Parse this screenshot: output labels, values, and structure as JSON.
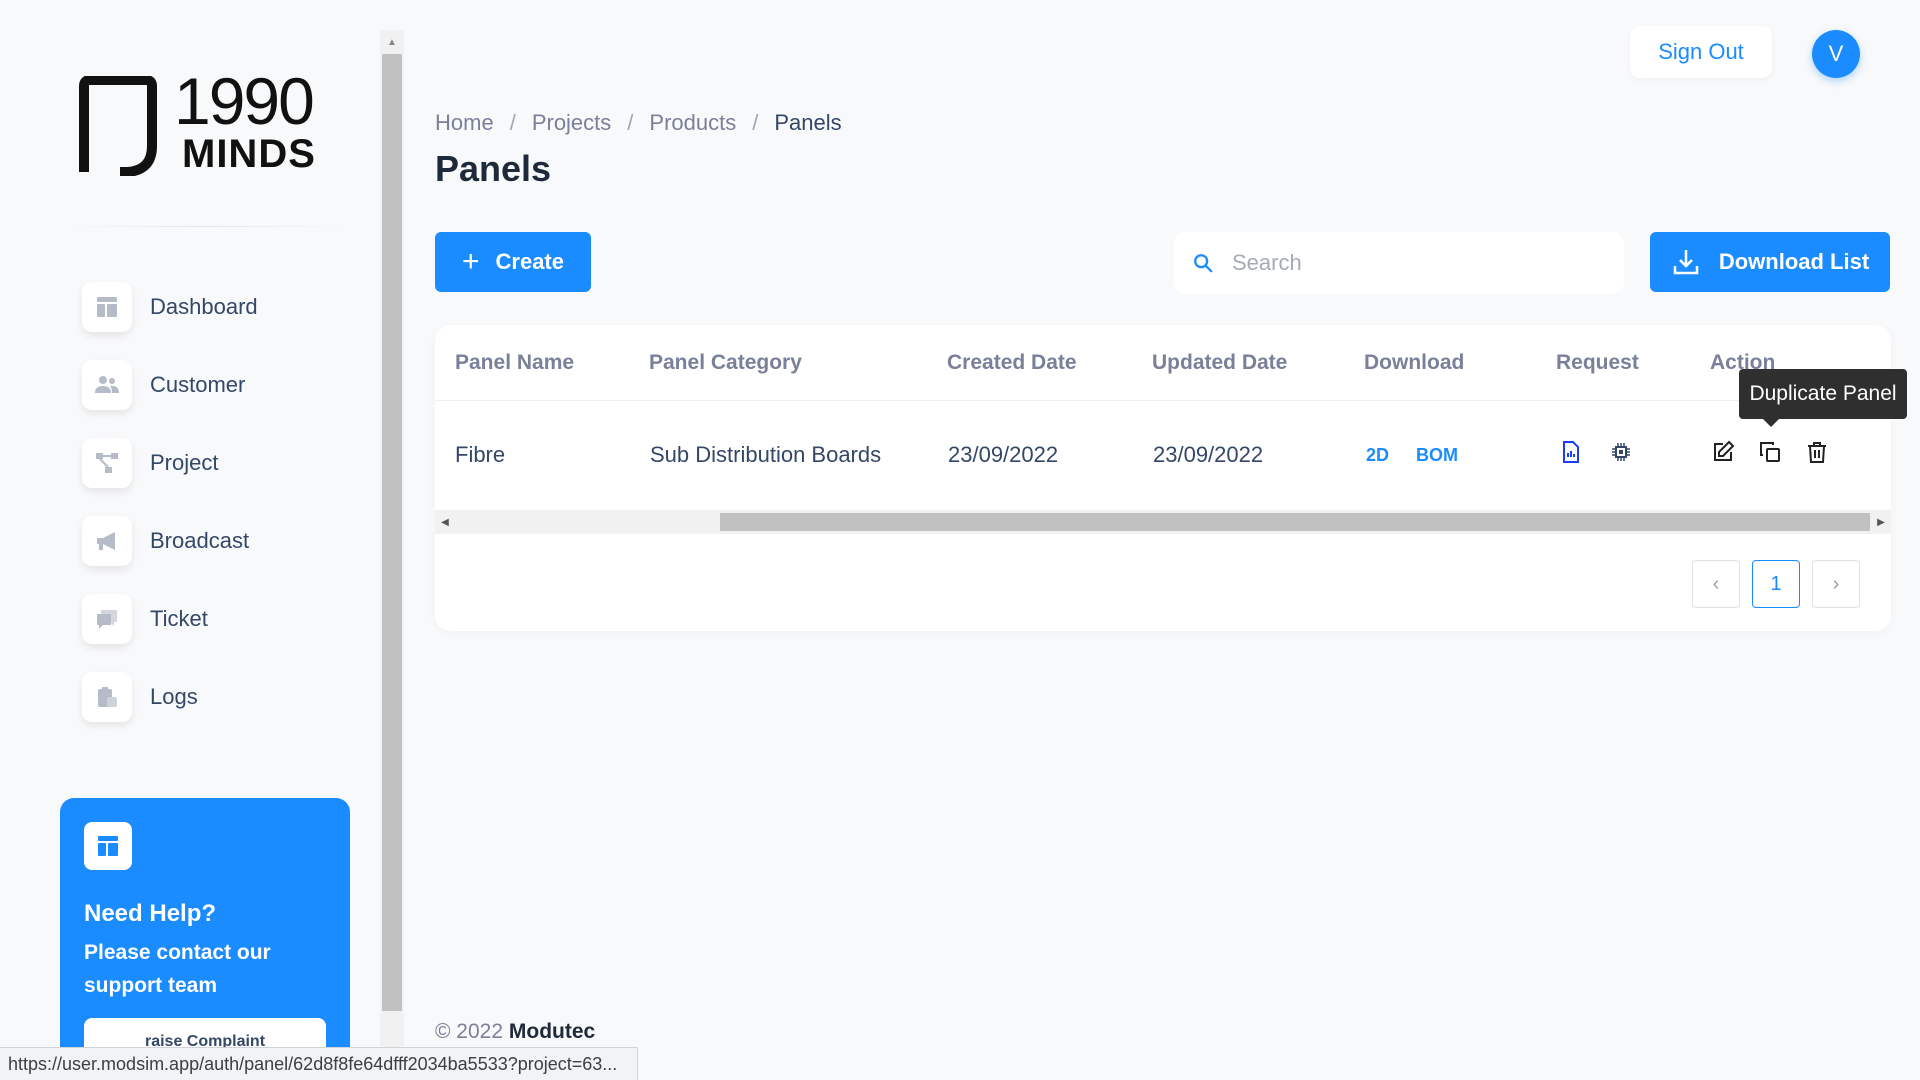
{
  "brand": {
    "logo_line1": "1990",
    "logo_line2": "MINDS"
  },
  "sidebar": {
    "items": [
      {
        "label": "Dashboard",
        "icon": "dashboard-icon"
      },
      {
        "label": "Customer",
        "icon": "customer-icon"
      },
      {
        "label": "Project",
        "icon": "project-icon"
      },
      {
        "label": "Broadcast",
        "icon": "broadcast-icon"
      },
      {
        "label": "Ticket",
        "icon": "ticket-icon"
      },
      {
        "label": "Logs",
        "icon": "logs-icon"
      }
    ],
    "help": {
      "title": "Need Help?",
      "text": "Please contact our support team",
      "button_label": "raise Complaint"
    }
  },
  "header": {
    "sign_out_label": "Sign Out",
    "avatar_initial": "V"
  },
  "breadcrumb": [
    "Home",
    "Projects",
    "Products",
    "Panels"
  ],
  "page_title": "Panels",
  "toolbar": {
    "create_label": "Create",
    "search_placeholder": "Search",
    "download_label": "Download List"
  },
  "table": {
    "columns": [
      "Panel Name",
      "Panel Category",
      "Created Date",
      "Updated Date",
      "Download",
      "Request",
      "Action"
    ],
    "rows": [
      {
        "panel_name": "Fibre",
        "panel_category": "Sub Distribution Boards",
        "created_date": "23/09/2022",
        "updated_date": "23/09/2022",
        "download_links": [
          "2D",
          "BOM"
        ]
      }
    ]
  },
  "pagination": {
    "current_page": "1"
  },
  "tooltip": "Duplicate Panel",
  "footer": {
    "copyright": "© 2022",
    "company": "Modutec"
  },
  "status_bar_url": "https://user.modsim.app/auth/panel/62d8f8fe64dfff2034ba5533?project=63...",
  "colors": {
    "primary": "#1a8cff",
    "text": "#344767",
    "muted": "#7b809a"
  }
}
